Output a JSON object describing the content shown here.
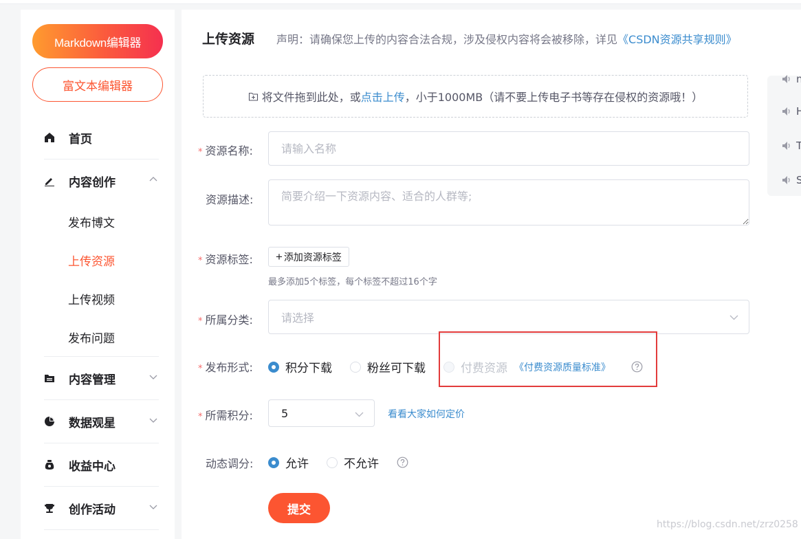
{
  "sidebar": {
    "markdown_btn": "Markdown编辑器",
    "richtext_btn": "富文本编辑器",
    "nav": {
      "home": "首页",
      "content_create": "内容创作",
      "sub": [
        "发布博文",
        "上传资源",
        "上传视频",
        "发布问题"
      ],
      "content_manage": "内容管理",
      "data": "数据观星",
      "income": "收益中心",
      "activity": "创作活动"
    }
  },
  "main": {
    "title": "上传资源",
    "notice": "声明：请确保您上传的内容合法合规，涉及侵权内容将会被移除，详见",
    "notice_link": "《CSDN资源共享规则》",
    "dropzone": {
      "pre": "将文件拖到此处，或",
      "link": "点击上传",
      "post": "，小于1000MB（请不要上传电子书等存在侵权的资源哦！）"
    },
    "form": {
      "name_label": "资源名称:",
      "name_placeholder": "请输入名称",
      "desc_label": "资源描述:",
      "desc_placeholder": "简要介绍一下资源内容、适合的人群等;",
      "tag_label": "资源标签:",
      "tag_btn": "添加资源标签",
      "tag_hint": "最多添加5个标签，每个标签不超过16个字",
      "category_label": "所属分类:",
      "category_placeholder": "请选择",
      "publish_label": "发布形式:",
      "publish_options": [
        "积分下载",
        "粉丝可下载",
        "付费资源"
      ],
      "paid_link": "《付费资源质量标准》",
      "points_label": "所需积分:",
      "points_value": "5",
      "price_link": "看看大家如何定价",
      "dynamic_label": "动态调分:",
      "dynamic_options": [
        "允许",
        "不允许"
      ],
      "submit": "提交"
    }
  },
  "right_panel": {
    "items": [
      "n",
      "H",
      "T",
      "S"
    ]
  },
  "watermark": "https://blog.csdn.net/zrz0258",
  "colors": {
    "accent": "#fc5531",
    "link": "#3b8cce",
    "highlight_box": "#e23b3b"
  }
}
